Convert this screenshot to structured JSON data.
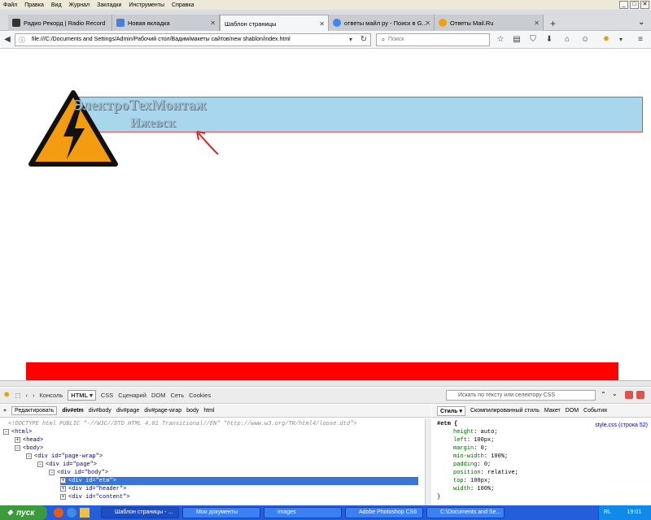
{
  "menubar": [
    "Файл",
    "Правка",
    "Вид",
    "Журнал",
    "Закладки",
    "Инструменты",
    "Справка"
  ],
  "window_controls": {
    "minimize": "_",
    "maximize": "□",
    "close": "✕"
  },
  "tabs": [
    {
      "label": "Радио Рекорд | Radio Record",
      "color": "#333333"
    },
    {
      "label": "Новая вкладка",
      "color": "#4a7fd6"
    },
    {
      "label": "Шаблон страницы",
      "color": "#f5f6f7"
    },
    {
      "label": "ответы майл ру - Поиск в G...",
      "color": "#4285f4"
    },
    {
      "label": "Ответы Mail.Ru",
      "color": "#f59e0b"
    }
  ],
  "new_tab_label": "+",
  "address": "file:///C:/Documents and Settings/Admin/Рабочий стол/Вадим/макеты сайтов/new shablon/index.html",
  "search_placeholder": "Поиск",
  "page": {
    "etm_title": "ЭлектроТехМонтаж",
    "etm_city": "Ижевск"
  },
  "firebug": {
    "toolbar_tabs": [
      "Консоль",
      "HTML ▾",
      "CSS",
      "Сценарий",
      "DOM",
      "Сеть",
      "Cookies"
    ],
    "search_placeholder": "Искать по тексту или селектору CSS",
    "breadcrumb_edit": "Редактировать",
    "breadcrumb": [
      "div#etm",
      "div#body",
      "div#page",
      "div#page-wrap",
      "body",
      "html"
    ],
    "html_lines": [
      {
        "text": "<!DOCTYPE html PUBLIC \"-//W3C//DTD HTML 4.01 Transitional//EN\" \"http://www.w3.org/TR/html4/loose.dtd\">",
        "kind": "comment",
        "indent": 0,
        "toggle": ""
      },
      {
        "text": "<html>",
        "kind": "tag",
        "indent": 0,
        "toggle": "−"
      },
      {
        "text": "<head>",
        "kind": "tag",
        "indent": 1,
        "toggle": "+"
      },
      {
        "text": "<body>",
        "kind": "tag",
        "indent": 1,
        "toggle": "−"
      },
      {
        "text": "<div id=\"page-wrap\">",
        "kind": "tag",
        "indent": 2,
        "toggle": "−"
      },
      {
        "text": "<div id=\"page\">",
        "kind": "tag",
        "indent": 3,
        "toggle": "−"
      },
      {
        "text": "<div id=\"body\">",
        "kind": "tag",
        "indent": 4,
        "toggle": "−"
      },
      {
        "text": "<div id=\"etm\">",
        "kind": "tag",
        "indent": 5,
        "toggle": "+",
        "highlight": true
      },
      {
        "text": "<div id=\"header\">",
        "kind": "tag",
        "indent": 5,
        "toggle": "+"
      },
      {
        "text": "<div id=\"content\">",
        "kind": "tag",
        "indent": 5,
        "toggle": "+"
      }
    ],
    "side_tabs": [
      "Стиль ▾",
      "Скомпилированный стиль",
      "Макет",
      "DOM",
      "События"
    ],
    "css_selector": "#etm {",
    "css_source": "style.css (строка 52)",
    "css_props": [
      {
        "name": "height",
        "value": "auto;"
      },
      {
        "name": "left",
        "value": "100px;"
      },
      {
        "name": "margin",
        "value": "0;"
      },
      {
        "name": "min-width",
        "value": "100%;"
      },
      {
        "name": "padding",
        "value": "0;"
      },
      {
        "name": "position",
        "value": "relative;"
      },
      {
        "name": "top",
        "value": "100px;"
      },
      {
        "name": "width",
        "value": "100%;"
      }
    ],
    "css_close": "}"
  },
  "taskbar": {
    "start": "пуск",
    "tasks": [
      {
        "label": "Шаблон страницы - ..."
      },
      {
        "label": "Мои документы"
      },
      {
        "label": "images"
      },
      {
        "label": "Adobe Photoshop CS6"
      },
      {
        "label": "C:\\Documents and Se..."
      }
    ],
    "lang": "RL",
    "clock": "19:01"
  },
  "colors": {
    "etm_bg": "#a7d6ed",
    "red_bar": "#ff0000",
    "taskbar": "#245edb",
    "start": "#3c9a3c"
  }
}
